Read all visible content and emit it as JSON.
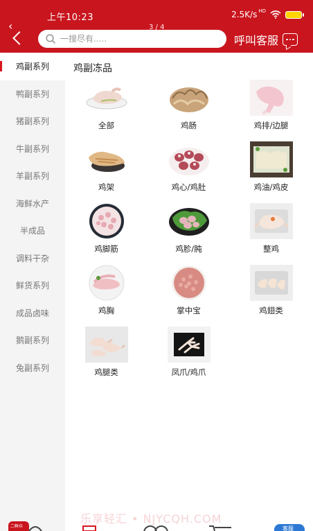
{
  "status_bar": {
    "time": "上午10:23",
    "network_speed": "2.5K/s",
    "hd_label": "HD"
  },
  "header": {
    "page_indicator": "3 / 4",
    "search": {
      "placeholder": "一搜尽有....."
    },
    "service_label": "呼叫客服"
  },
  "sidebar": {
    "active_index": 0,
    "items": [
      {
        "label": "鸡副系列"
      },
      {
        "label": "鸭副系列"
      },
      {
        "label": "猪副系列"
      },
      {
        "label": "牛副系列"
      },
      {
        "label": "羊副系列"
      },
      {
        "label": "海鲜水产"
      },
      {
        "label": "半成品"
      },
      {
        "label": "调料干杂"
      },
      {
        "label": "鲜货系列"
      },
      {
        "label": "成品卤味"
      },
      {
        "label": "鹅副系列"
      },
      {
        "label": "兔副系列"
      }
    ]
  },
  "content": {
    "section_title": "鸡副冻品",
    "products": [
      {
        "label": "全部",
        "icon": "whole-chicken-plate-icon"
      },
      {
        "label": "鸡肠",
        "icon": "chicken-intestine-icon"
      },
      {
        "label": "鸡排/边腿",
        "icon": "chicken-leg-quarter-icon"
      },
      {
        "label": "鸡架",
        "icon": "chicken-frame-icon"
      },
      {
        "label": "鸡心/鸡肚",
        "icon": "chicken-heart-gizzard-icon"
      },
      {
        "label": "鸡油/鸡皮",
        "icon": "chicken-fat-skin-icon"
      },
      {
        "label": "鸡脚筋",
        "icon": "chicken-tendon-icon"
      },
      {
        "label": "鸡胗/肫",
        "icon": "chicken-gizzard-icon"
      },
      {
        "label": "整鸡",
        "icon": "whole-chicken-icon"
      },
      {
        "label": "鸡胸",
        "icon": "chicken-breast-icon"
      },
      {
        "label": "掌中宝",
        "icon": "chicken-cartilage-icon"
      },
      {
        "label": "鸡翅类",
        "icon": "chicken-wings-icon"
      },
      {
        "label": "鸡腿类",
        "icon": "chicken-drumsticks-icon"
      },
      {
        "label": "凤爪/鸡爪",
        "icon": "chicken-feet-icon"
      }
    ]
  },
  "footer": {
    "watermark": "乐享轻汇 • NJYCQH.COM",
    "brand_badge": "二鲜众",
    "service_badge": "客服"
  },
  "colors": {
    "brand_red": "#c9151e",
    "sidebar_bg": "#f4f4f4",
    "active_marker": "#d9141c",
    "service_blue": "#2c78d4"
  }
}
